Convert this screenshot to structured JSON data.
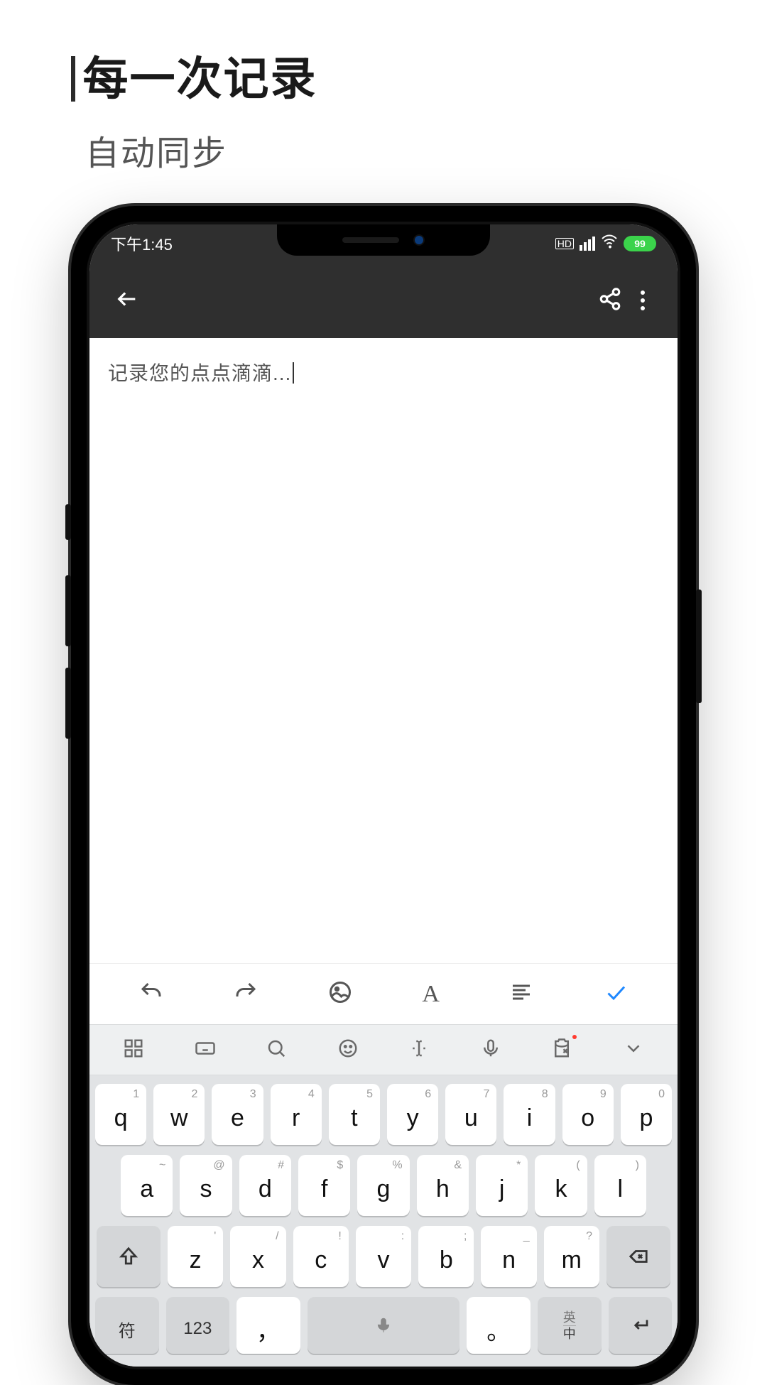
{
  "marketing": {
    "title": "每一次记录",
    "subtitle": "自动同步"
  },
  "status": {
    "time": "下午1:45",
    "network_label": "HD",
    "battery_percent": "99"
  },
  "editor": {
    "placeholder": "记录您的点点滴滴..."
  },
  "format_toolbar": {
    "undo": "undo",
    "redo": "redo",
    "image": "image",
    "text_style": "A",
    "align": "align",
    "done": "done"
  },
  "ime_toolbar": {
    "grid": "grid",
    "keyboard": "keyboard",
    "search": "search",
    "emoji": "emoji",
    "cursor": "cursor",
    "voice": "voice",
    "clipboard": "clipboard",
    "collapse": "collapse"
  },
  "keyboard": {
    "row1": [
      {
        "sup": "1",
        "main": "q"
      },
      {
        "sup": "2",
        "main": "w"
      },
      {
        "sup": "3",
        "main": "e"
      },
      {
        "sup": "4",
        "main": "r"
      },
      {
        "sup": "5",
        "main": "t"
      },
      {
        "sup": "6",
        "main": "y"
      },
      {
        "sup": "7",
        "main": "u"
      },
      {
        "sup": "8",
        "main": "i"
      },
      {
        "sup": "9",
        "main": "o"
      },
      {
        "sup": "0",
        "main": "p"
      }
    ],
    "row2": [
      {
        "sup": "~",
        "main": "a"
      },
      {
        "sup": "@",
        "main": "s"
      },
      {
        "sup": "#",
        "main": "d"
      },
      {
        "sup": "$",
        "main": "f"
      },
      {
        "sup": "%",
        "main": "g"
      },
      {
        "sup": "&",
        "main": "h"
      },
      {
        "sup": "*",
        "main": "j"
      },
      {
        "sup": "(",
        "main": "k"
      },
      {
        "sup": ")",
        "main": "l"
      }
    ],
    "row3": [
      {
        "sup": "'",
        "main": "z"
      },
      {
        "sup": "/",
        "main": "x"
      },
      {
        "sup": "!",
        "main": "c"
      },
      {
        "sup": ":",
        "main": "v"
      },
      {
        "sup": ";",
        "main": "b"
      },
      {
        "sup": "_",
        "main": "n"
      },
      {
        "sup": "?",
        "main": "m"
      }
    ],
    "row4": {
      "symbols": "符",
      "numbers": "123",
      "comma": "，",
      "period": "。",
      "lang_top": "英",
      "lang_bot": "中"
    }
  }
}
